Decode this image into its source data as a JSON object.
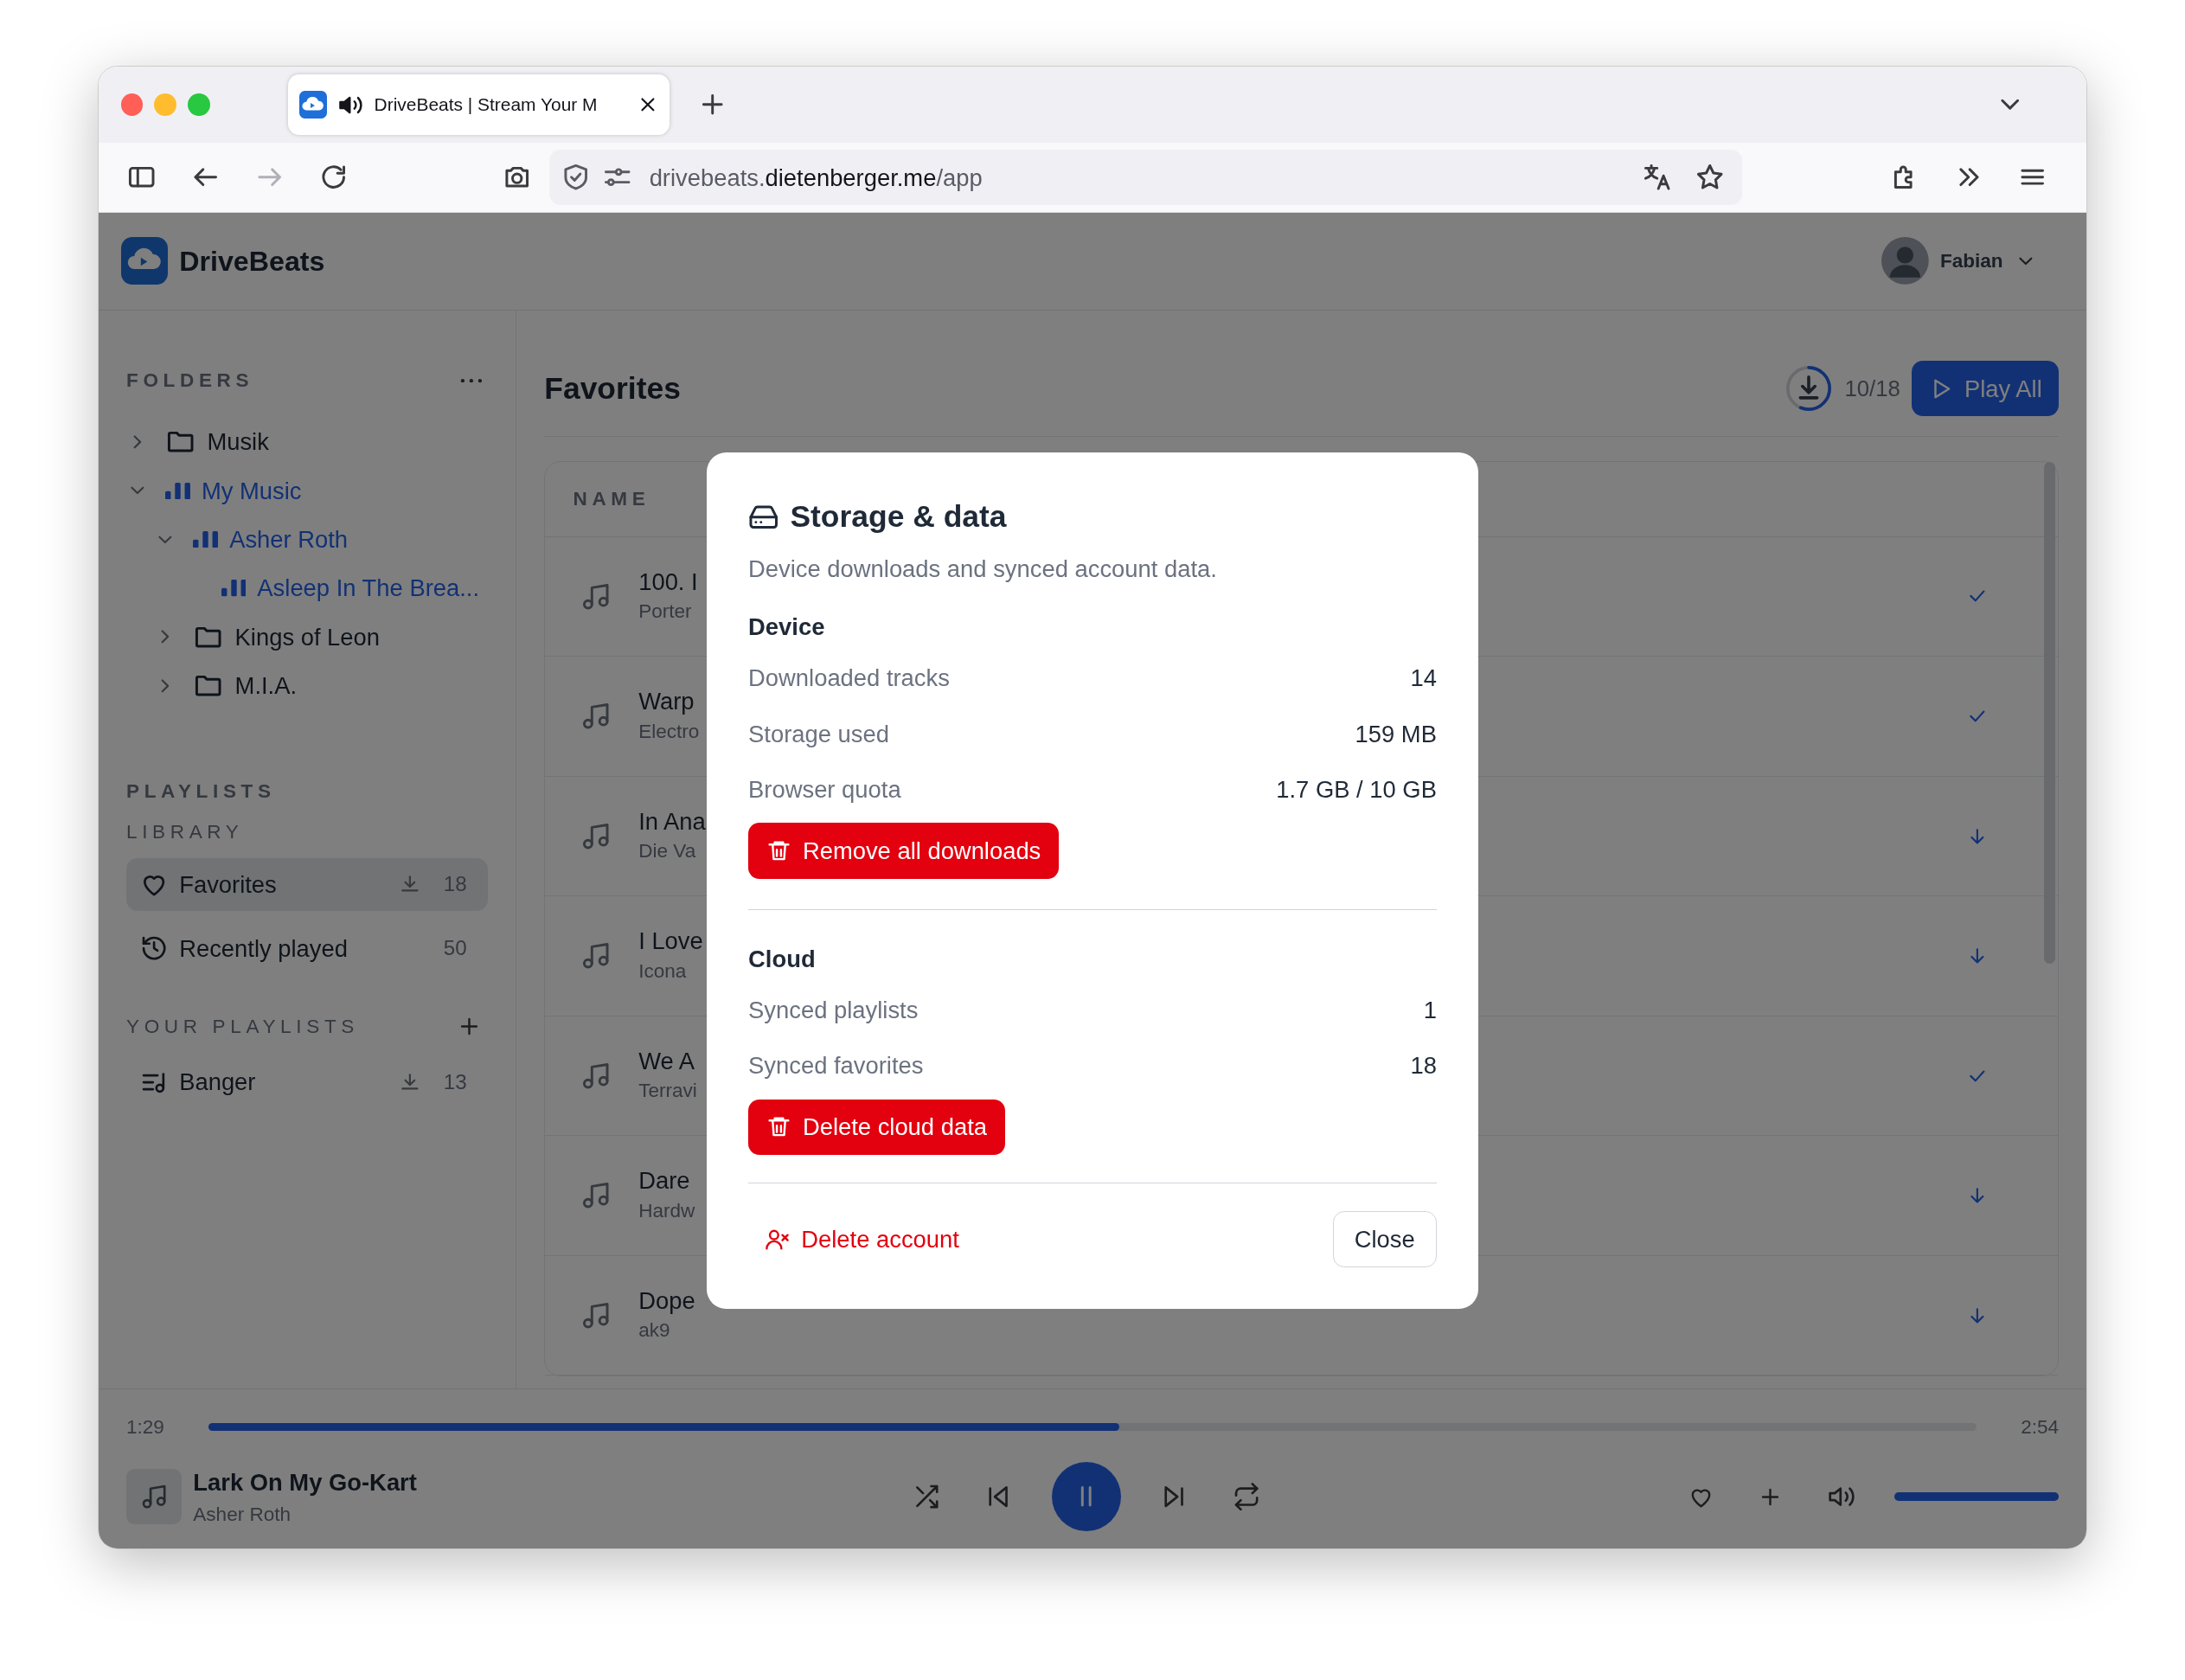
{
  "browser": {
    "tab": {
      "title": "DriveBeats | Stream Your M"
    },
    "url": "drivebeats.**dietenberger.me**/app",
    "can_go_forward": false
  },
  "app": {
    "name": "DriveBeats",
    "user": "Fabian"
  },
  "sidebar": {
    "folders_heading": "FOLDERS",
    "folders": [
      {
        "kind": "folder",
        "label": "Musik",
        "expanded": false,
        "playing": false
      },
      {
        "kind": "folder",
        "label": "My Music",
        "expanded": true,
        "playing": true,
        "children": [
          {
            "kind": "folder",
            "label": "Asher Roth",
            "expanded": true,
            "playing": true,
            "children": [
              {
                "kind": "track",
                "label": "Asleep In The Brea...",
                "playing": true
              }
            ]
          },
          {
            "kind": "folder",
            "label": "Kings of Leon",
            "expanded": false,
            "playing": false
          },
          {
            "kind": "folder",
            "label": "M.I.A.",
            "expanded": false,
            "playing": false
          }
        ]
      }
    ],
    "playlists_heading": "PLAYLISTS",
    "library_heading": "LIBRARY",
    "library": [
      {
        "kind": "favorites",
        "label": "Favorites",
        "downloadable": true,
        "count": "18",
        "selected": true
      },
      {
        "kind": "history",
        "label": "Recently played",
        "downloadable": false,
        "count": "50",
        "selected": false
      }
    ],
    "your_playlists_heading": "YOUR PLAYLISTS",
    "playlists": [
      {
        "label": "Banger",
        "downloadable": true,
        "count": "13",
        "selected": false
      }
    ]
  },
  "main": {
    "title": "Favorites",
    "download_progress": {
      "level": 0.56,
      "count": "10/18"
    },
    "play_all": "Play All",
    "column": "NAME",
    "tracks": [
      {
        "title": "100. I",
        "artist": "Porter",
        "downloaded": true
      },
      {
        "title": "Warp",
        "artist": "Electro",
        "downloaded": true
      },
      {
        "title": "In Ana",
        "artist": "Die Va",
        "downloaded": false
      },
      {
        "title": "I Love",
        "artist": "Icona",
        "downloaded": false
      },
      {
        "title": "We A",
        "artist": "Terravi",
        "downloaded": true
      },
      {
        "title": "Dare",
        "artist": "Hardw",
        "downloaded": false
      },
      {
        "title": "Dope",
        "artist": "ak9",
        "downloaded": false
      }
    ]
  },
  "player": {
    "elapsed": "1:29",
    "duration": "2:54",
    "level": 0.515,
    "title": "Lark On My Go-Kart",
    "artist": "Asher Roth",
    "playing": true,
    "volume": {
      "level": 1
    }
  },
  "dialog": {
    "title": "Storage & data",
    "subtitle": "Device downloads and synced account data.",
    "sections": [
      {
        "heading": "Device",
        "rows": [
          {
            "label": "Downloaded tracks",
            "value": "14"
          },
          {
            "label": "Storage used",
            "value": "159 MB"
          },
          {
            "label": "Browser quota",
            "value": "1.7 GB / 10 GB"
          }
        ],
        "action": "Remove all downloads"
      },
      {
        "heading": "Cloud",
        "rows": [
          {
            "label": "Synced playlists",
            "value": "1"
          },
          {
            "label": "Synced favorites",
            "value": "18"
          }
        ],
        "action": "Delete cloud data"
      }
    ],
    "delete_account": "Delete account",
    "close": "Close"
  }
}
